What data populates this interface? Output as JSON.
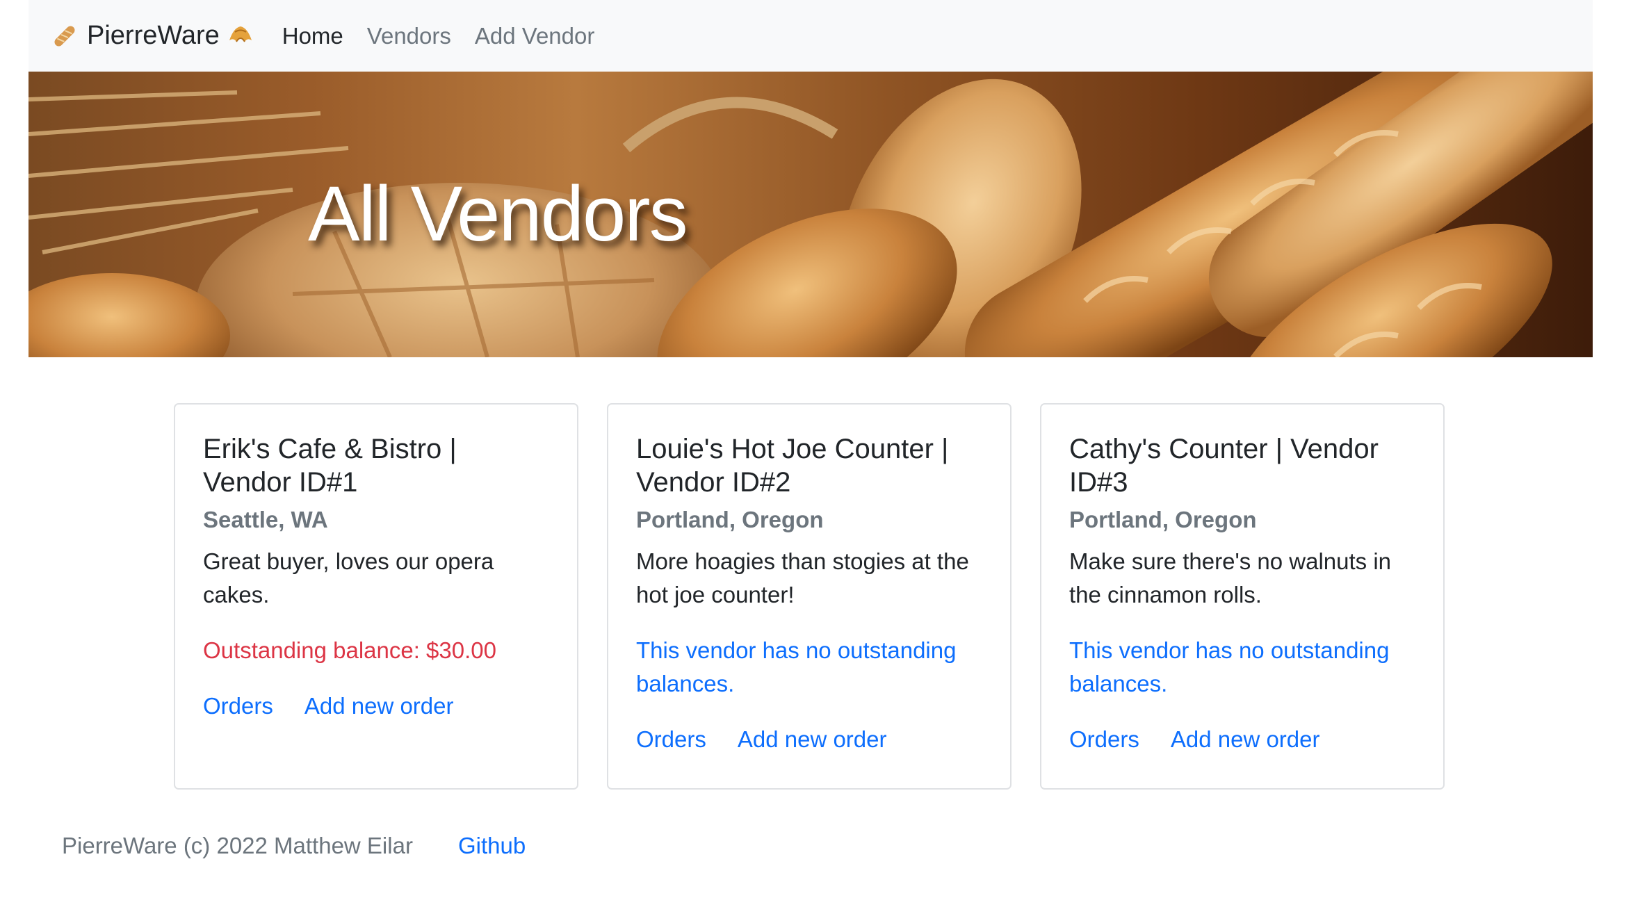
{
  "navbar": {
    "brand": "PierreWare",
    "brand_left_icon": "baguette-icon",
    "brand_right_icon": "croissant-icon",
    "links": [
      {
        "label": "Home",
        "active": true
      },
      {
        "label": "Vendors",
        "active": false
      },
      {
        "label": "Add Vendor",
        "active": false
      }
    ]
  },
  "hero": {
    "title": "All Vendors",
    "background": "bread-photo"
  },
  "vendors": [
    {
      "title": "Erik's Cafe & Bistro | Vendor ID#1",
      "location": "Seattle, WA",
      "description": "Great buyer, loves our opera cakes.",
      "balance": "Outstanding balance: $30.00",
      "orders_label": "Orders",
      "add_order_label": "Add new order"
    },
    {
      "title": "Louie's Hot Joe Counter | Vendor ID#2",
      "location": "Portland, Oregon",
      "description": "More hoagies than stogies at the hot joe counter!",
      "balance": "This vendor has no outstanding balances.",
      "orders_label": "Orders",
      "add_order_label": "Add new order"
    },
    {
      "title": "Cathy's Counter | Vendor ID#3",
      "location": "Portland, Oregon",
      "description": "Make sure there's no walnuts in the cinnamon rolls.",
      "balance": "This vendor has no outstanding balances.",
      "orders_label": "Orders",
      "add_order_label": "Add new order"
    }
  ],
  "footer": {
    "copyright": "PierreWare (c) 2022 Matthew Eilar",
    "github_label": "Github"
  },
  "colors": {
    "link": "#0d6efd",
    "danger": "#dc3545",
    "muted": "#6c757d",
    "navbar_bg": "#f8f9fa"
  }
}
